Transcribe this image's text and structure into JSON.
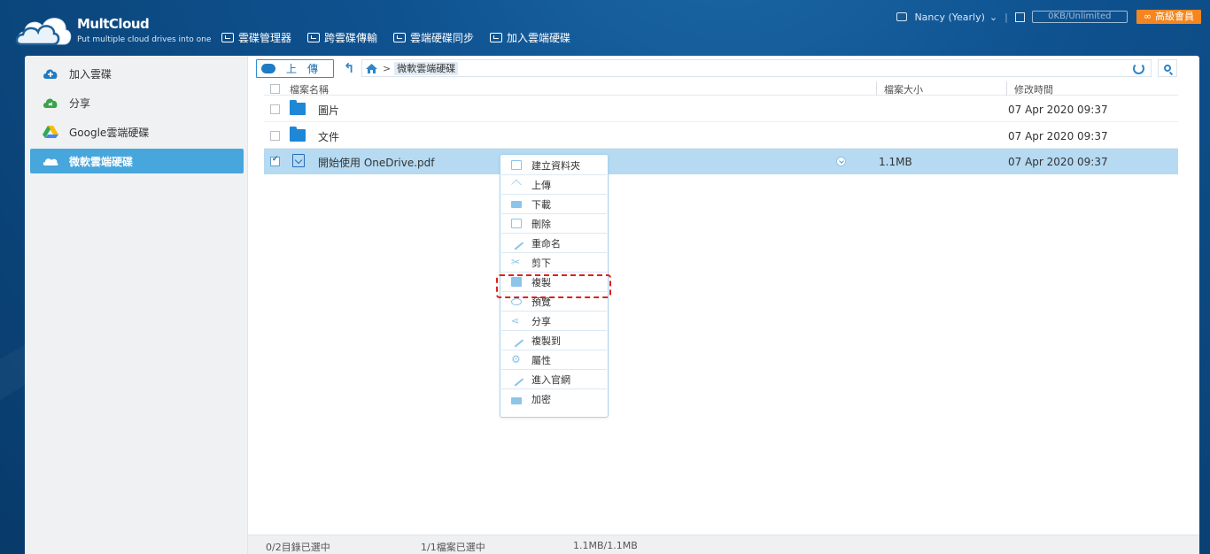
{
  "app": {
    "name": "MultCloud",
    "tagline": "Put multiple cloud drives into one"
  },
  "topnav": [
    {
      "label": "雲碟管理器",
      "icon": "cloud-manager-icon"
    },
    {
      "label": "跨雲碟傳輸",
      "icon": "transfer-icon"
    },
    {
      "label": "雲端硬碟同步",
      "icon": "sync-icon"
    },
    {
      "label": "加入雲端硬碟",
      "icon": "add-cloud-icon"
    }
  ],
  "user": {
    "name": "Nancy (Yearly)",
    "storage": "0KB/Unlimited",
    "premium_label": "高級會員",
    "separator": "|"
  },
  "sidebar": {
    "items": [
      {
        "label": "加入雲碟",
        "icon": "add-cloud-icon",
        "active": false
      },
      {
        "label": "分享",
        "icon": "share-cloud-icon",
        "active": false
      },
      {
        "label": "Google雲端硬碟",
        "icon": "google-drive-icon",
        "active": false
      },
      {
        "label": "微軟雲端硬碟",
        "icon": "onedrive-icon",
        "active": true
      }
    ]
  },
  "toolbar": {
    "upload_label": "上傳",
    "breadcrumb": "微軟雲端硬碟",
    "crumb_sep": ">"
  },
  "table": {
    "columns": {
      "name": "檔案名稱",
      "size": "檔案大小",
      "time": "修改時間"
    },
    "rows": [
      {
        "name": "圖片",
        "type": "folder",
        "size": "",
        "time": "07 Apr 2020 09:37",
        "selected": false
      },
      {
        "name": "文件",
        "type": "folder",
        "size": "",
        "time": "07 Apr 2020 09:37",
        "selected": false
      },
      {
        "name": "開始使用 OneDrive.pdf",
        "type": "pdf",
        "size": "1.1MB",
        "time": "07 Apr 2020 09:37",
        "selected": true
      }
    ]
  },
  "context_menu": [
    {
      "label": "建立資料夾",
      "icon": "new-folder-icon"
    },
    {
      "label": "上傳",
      "icon": "upload-icon"
    },
    {
      "label": "下載",
      "icon": "download-icon"
    },
    {
      "label": "刪除",
      "icon": "trash-icon"
    },
    {
      "label": "重命名",
      "icon": "pencil-icon"
    },
    {
      "label": "剪下",
      "icon": "scissors-icon"
    },
    {
      "label": "複製",
      "icon": "copy-icon"
    },
    {
      "label": "預覽",
      "icon": "eye-icon"
    },
    {
      "label": "分享",
      "icon": "share-icon"
    },
    {
      "label": "複製到",
      "icon": "copy-to-icon"
    },
    {
      "label": "屬性",
      "icon": "gear-icon"
    },
    {
      "label": "進入官網",
      "icon": "official-site-icon"
    },
    {
      "label": "加密",
      "icon": "lock-icon"
    }
  ],
  "status": {
    "dirs": "0/2目錄已選中",
    "files": "1/1檔案已選中",
    "size": "1.1MB/1.1MB"
  },
  "colors": {
    "header": "#0f5290",
    "accent": "#47a6dc",
    "premium": "#f5861f",
    "selected_row": "#b5daf2",
    "highlight": "#e0201a"
  }
}
